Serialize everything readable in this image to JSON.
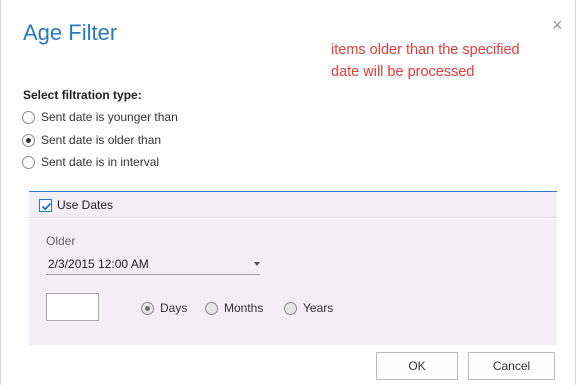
{
  "dialog": {
    "title": "Age Filter",
    "close_glyph": "×",
    "annotation_line1": "items older than the specified",
    "annotation_line2": "date will be processed"
  },
  "filtration": {
    "label": "Select filtration type:",
    "options": [
      {
        "label": "Sent date is younger than",
        "checked": false
      },
      {
        "label": "Sent date is older than",
        "checked": true
      },
      {
        "label": "Sent date is in interval",
        "checked": false
      }
    ]
  },
  "use_dates": {
    "label": "Use Dates",
    "checked": true
  },
  "older": {
    "label": "Older",
    "date_value": "2/3/2015 12:00 AM",
    "number_value": ""
  },
  "units": [
    {
      "label": "Days",
      "checked": true
    },
    {
      "label": "Months",
      "checked": false
    },
    {
      "label": "Years",
      "checked": false
    }
  ],
  "buttons": {
    "ok": "OK",
    "cancel": "Cancel"
  },
  "colors": {
    "accent": "#2a7abf",
    "annotation": "#e83a3a",
    "panel": "#f3eef3"
  }
}
